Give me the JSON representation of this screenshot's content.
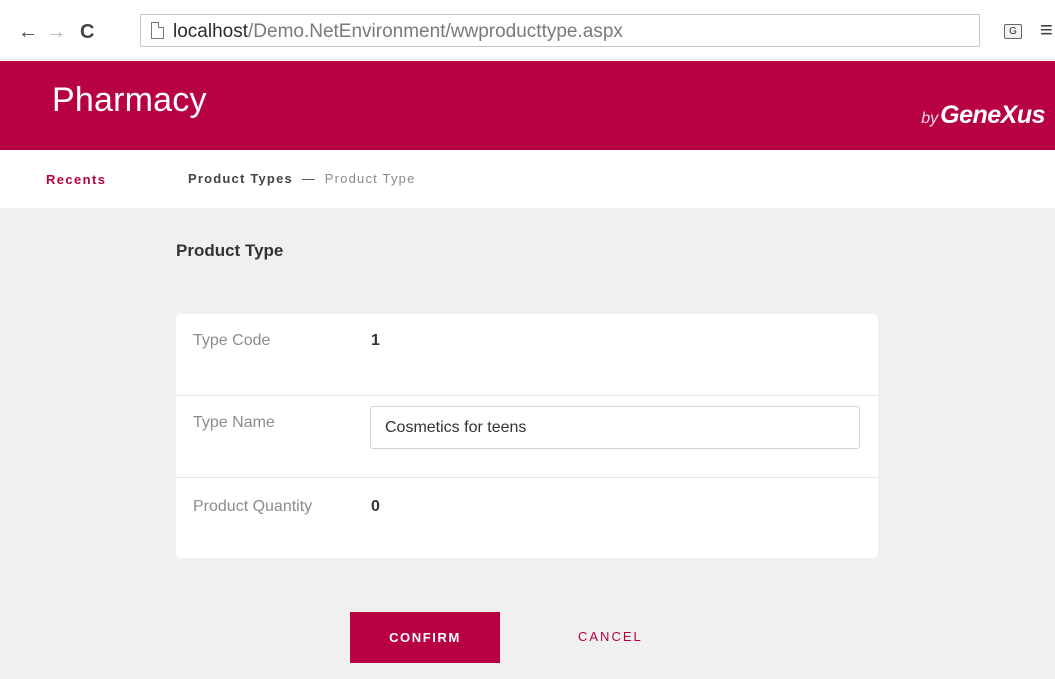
{
  "browser": {
    "back_icon": "←",
    "forward_icon": "→",
    "reload_icon": "C",
    "url_host": "localhost",
    "url_path": "/Demo.NetEnvironment/wwproducttype.aspx",
    "translate_icon": "G",
    "menu_icon": "≡"
  },
  "header": {
    "title": "Pharmacy",
    "brand_by": "by",
    "brand_name": "GeneXus"
  },
  "breadcrumb": {
    "recents": "Recents",
    "parent": "Product Types",
    "separator": "—",
    "current": "Product Type"
  },
  "form": {
    "title": "Product Type",
    "fields": [
      {
        "label": "Type Code",
        "value": "1"
      },
      {
        "label": "Type Name",
        "value": "Cosmetics for teens"
      },
      {
        "label": "Product Quantity",
        "value": "0"
      }
    ],
    "confirm_label": "CONFIRM",
    "cancel_label": "CANCEL"
  },
  "colors": {
    "brand": "#b80143",
    "background": "#f0f0f0"
  }
}
